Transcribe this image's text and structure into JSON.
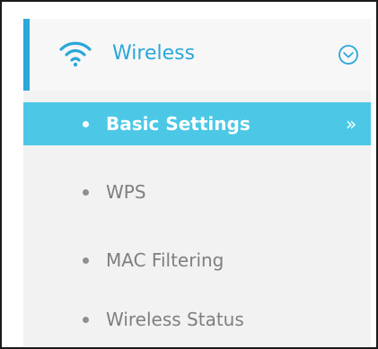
{
  "window": {
    "title": "Wireless"
  },
  "sidebar": {
    "section": {
      "title": "Wireless",
      "icon": "wifi-icon",
      "expand_icon": "chevron-down-circle-icon",
      "accent_color": "#2ba7d9"
    },
    "items": [
      {
        "label": "Basic Settings",
        "active": true,
        "arrow": "»",
        "background": "#4cc8e6",
        "text_color": "#ffffff"
      },
      {
        "label": "WPS",
        "active": false
      },
      {
        "label": "MAC Filtering",
        "active": false
      },
      {
        "label": "Wireless Status",
        "active": false
      }
    ]
  }
}
